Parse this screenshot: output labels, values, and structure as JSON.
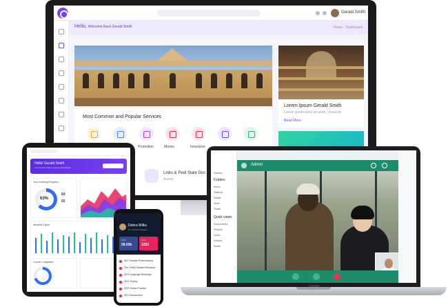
{
  "monitor": {
    "topbar": {
      "user_name": "Gerald Smith"
    },
    "welcome": {
      "hello": "Hello,",
      "message": "Welcome Back Gerald Smith",
      "breadcrumb": "Home - Dashboard"
    },
    "services": {
      "title": "Most Common and Popular Services",
      "items": [
        {
          "label": "",
          "icon": "tag-icon",
          "color": "#f5a623"
        },
        {
          "label": "",
          "icon": "card-icon",
          "color": "#4a7cf6"
        },
        {
          "label": "Promotion",
          "icon": "gift-icon",
          "color": "#b03ff2"
        },
        {
          "label": "Money",
          "icon": "money-icon",
          "color": "#e6245b"
        },
        {
          "label": "Insurance",
          "icon": "truck-icon",
          "color": "#e6245b"
        },
        {
          "label": "",
          "icon": "medal-icon",
          "color": "#7b3ff2"
        },
        {
          "label": "",
          "icon": "send-icon",
          "color": "#22b573"
        }
      ]
    },
    "feature": {
      "title": "Lorem Ipsum Gerald Smith",
      "subtitle": "Lorem ipsum dolor sit amet, consecte",
      "link": "Read More"
    },
    "doc": {
      "title": "Links & Pedi State Doc",
      "subtitle": "Assets"
    }
  },
  "tablet": {
    "hero": {
      "title": "Hello! Gerald Smith",
      "subtitle": "Lorem ipsum dolor sit amet consectetur"
    },
    "course_progress": {
      "title": "Your Learning Progress",
      "percent": "63%"
    },
    "students": {
      "title": "Students Types"
    },
    "courses": {
      "title": "Course Completed"
    },
    "stats": [
      {
        "value": "84"
      },
      {
        "value": "65"
      }
    ]
  },
  "phone": {
    "name": "Debra Wilks",
    "role": "Sr. Product Designer",
    "stats": [
      {
        "label": "Total",
        "value": "28.03k",
        "color": "#3a4a8f"
      },
      {
        "label": "Total",
        "value": "1252",
        "color": "#e6245b"
      }
    ],
    "items": [
      "SIS Tutorials Presentations",
      "The CMMU Market Research",
      "SEO Language Redesign",
      "SEO Testing",
      "SEO Online Practice",
      "SEO Introduction"
    ]
  },
  "laptop": {
    "call_title": "Admin",
    "brand": "Laptop",
    "sidebar": {
      "search": "Search",
      "folders_heading": "Folders",
      "folders": [
        "Inbox",
        "Starred",
        "Drafts",
        "Sent",
        "Trash"
      ],
      "quick_heading": "Quick views",
      "quick": [
        "Documents",
        "Photos",
        "Links",
        "Videos",
        "Audio"
      ]
    }
  }
}
